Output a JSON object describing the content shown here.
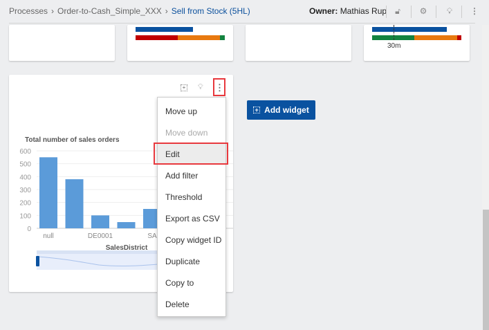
{
  "breadcrumb": [
    "Processes",
    "Order-to-Cash_Simple_XXX",
    "Sell from Stock (5HL)"
  ],
  "owner": {
    "label": "Owner:",
    "name": "Mathias Rup"
  },
  "header_icons": [
    "lock-icon",
    "settings-icon",
    "lightbulb-icon",
    "more-vertical-icon"
  ],
  "top_cards": {
    "card4_label": "30m"
  },
  "colors": {
    "accent": "#0a52a0",
    "bar": "#5b9bd9",
    "red": "#c00000",
    "orange": "#e8790f",
    "green": "#138340",
    "highlight": "#e8383d"
  },
  "add_widget": {
    "label": "Add widget"
  },
  "menu": {
    "items": [
      {
        "label": "Move up",
        "disabled": false
      },
      {
        "label": "Move down",
        "disabled": true
      },
      {
        "label": "Edit",
        "disabled": false,
        "highlighted": true
      },
      {
        "label": "Add filter",
        "disabled": false
      },
      {
        "label": "Threshold",
        "disabled": false
      },
      {
        "label": "Export as CSV",
        "disabled": false
      },
      {
        "label": "Copy widget ID",
        "disabled": false
      },
      {
        "label": "Duplicate",
        "disabled": false
      },
      {
        "label": "Copy to",
        "disabled": false
      },
      {
        "label": "Delete",
        "disabled": false
      }
    ]
  },
  "chart_data": {
    "type": "bar",
    "title": "Total number of sales orders",
    "xlabel": "SalesDistrict",
    "ylabel": "",
    "ylim": [
      0,
      600
    ],
    "yticks": [
      0,
      100,
      200,
      300,
      400,
      500,
      600
    ],
    "categories": [
      "null",
      "",
      "DE0001",
      "",
      "SA"
    ],
    "values": [
      550,
      380,
      100,
      48,
      150
    ],
    "grid": true
  }
}
